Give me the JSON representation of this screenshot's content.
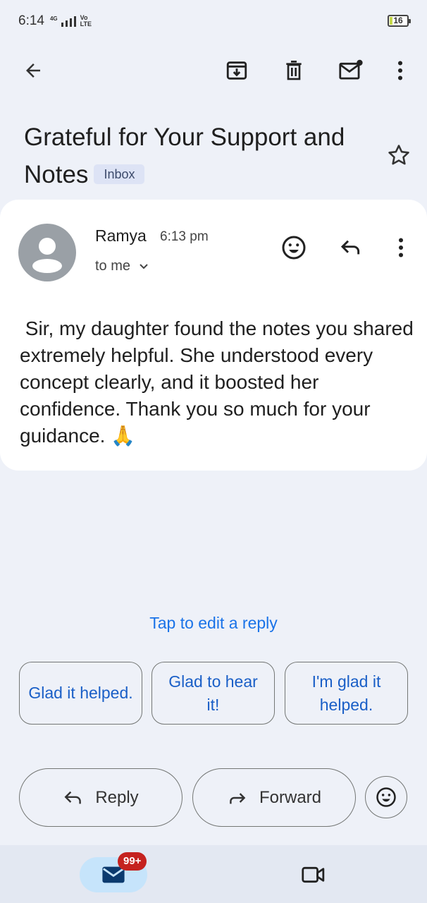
{
  "status": {
    "time": "6:14",
    "network": "4G",
    "volte": "Vo LTE",
    "battery": "16"
  },
  "toolbar": {
    "back_icon": "arrow-back-icon",
    "archive_icon": "archive-icon",
    "delete_icon": "trash-icon",
    "mark_unread_icon": "mail-unread-icon",
    "more_icon": "more-vertical-icon"
  },
  "email": {
    "subject": "Grateful for Your Support and Notes",
    "label": "Inbox",
    "sender": "Ramya",
    "time": "6:13 pm",
    "recipient": "to me",
    "body": " Sir, my daughter found the notes you shared extremely helpful. She understood every concept clearly, and it boosted her confidence. Thank you so much for your guidance. 🙏"
  },
  "smart_reply": {
    "hint": "Tap to edit a reply",
    "options": [
      "Glad it helped.",
      "Glad to hear it!",
      "I'm glad it helped."
    ]
  },
  "actions": {
    "reply": "Reply",
    "forward": "Forward"
  },
  "bottom_nav": {
    "mail_badge": "99+"
  },
  "colors": {
    "accent": "#1a73e8",
    "badge": "#c5221f",
    "background": "#eef1f8"
  }
}
